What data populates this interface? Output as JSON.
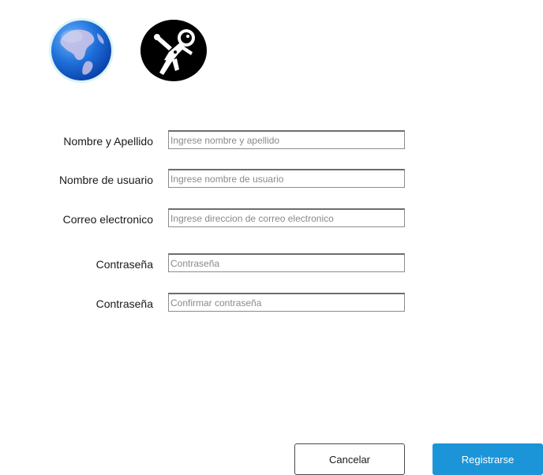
{
  "logos": {
    "globe_icon": "globe-icon",
    "astronaut_icon": "astronaut-icon"
  },
  "form": {
    "fields": [
      {
        "label": "Nombre y Apellido",
        "placeholder": "Ingrese nombre y apellido",
        "value": ""
      },
      {
        "label": "Nombre de usuario",
        "placeholder": "Ingrese nombre de usuario",
        "value": ""
      },
      {
        "label": "Correo electronico",
        "placeholder": "Ingrese direccion de correo electronico",
        "value": ""
      },
      {
        "label": "Contraseña",
        "placeholder": "Contraseña",
        "value": ""
      },
      {
        "label": "Contraseña",
        "placeholder": "Confirmar contraseña",
        "value": ""
      }
    ]
  },
  "actions": {
    "cancel_label": "Cancelar",
    "register_label": "Registrarse"
  },
  "colors": {
    "primary": "#1b95d8",
    "globe_blue": "#1e6fd9"
  }
}
